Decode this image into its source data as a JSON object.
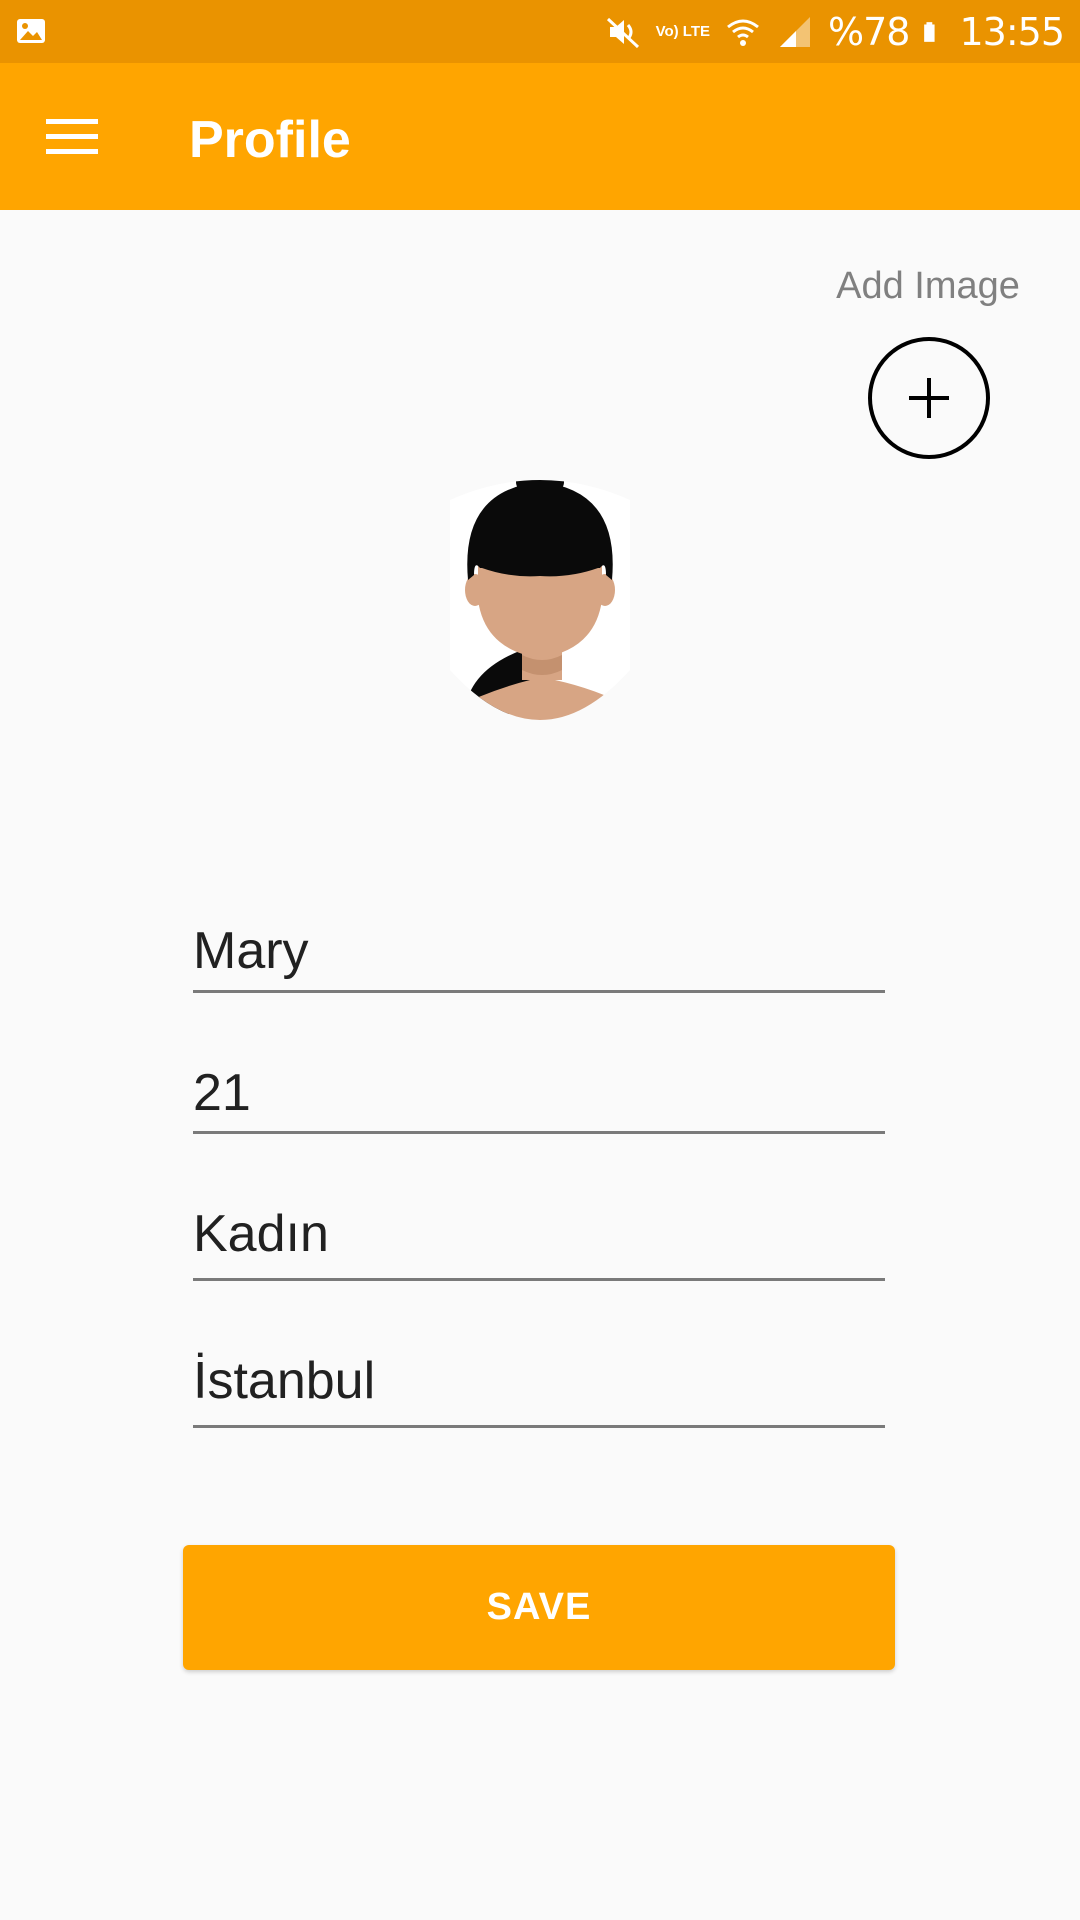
{
  "status_bar": {
    "battery": "%78",
    "time": "13:55",
    "network_label": "Vo) LTE",
    "icons": [
      "gallery-icon",
      "mute-icon",
      "volte-icon",
      "wifi-icon",
      "signal-icon",
      "battery-icon"
    ]
  },
  "app_bar": {
    "title": "Profile",
    "menu_icon": "menu-icon"
  },
  "add_image": {
    "label": "Add Image",
    "icon": "plus-icon"
  },
  "avatar": {
    "icon": "female-avatar-icon"
  },
  "form": {
    "name": "Mary",
    "age": "21",
    "gender": "Kadın",
    "city": "İstanbul"
  },
  "save_button": {
    "label": "SAVE"
  },
  "colors": {
    "status_bar": "#ea9300",
    "accent": "#ffa500",
    "background": "#fafafa",
    "text": "#212121",
    "hint": "#808080"
  }
}
